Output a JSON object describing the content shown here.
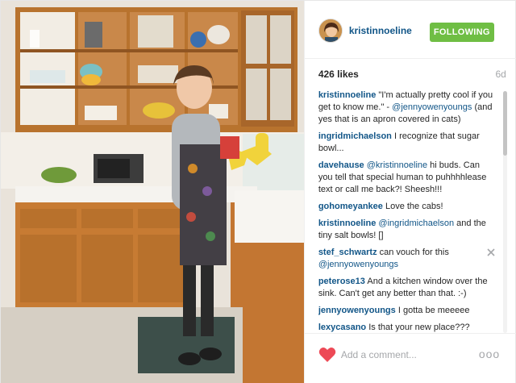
{
  "post": {
    "username": "kristinnoeline",
    "follow_label": "FOLLOWING",
    "likes": "426 likes",
    "age": "6d",
    "comments": [
      {
        "author": "kristinnoeline",
        "parts": [
          {
            "t": "\"I'm actually pretty cool if you get to know me.\" - "
          },
          {
            "m": "@jennyowenyoungs"
          },
          {
            "t": " (and yes that is an apron covered in cats)"
          }
        ]
      },
      {
        "author": "ingridmichaelson",
        "parts": [
          {
            "t": "I recognize that sugar bowl..."
          }
        ]
      },
      {
        "author": "davehause",
        "parts": [
          {
            "m": "@kristinnoeline"
          },
          {
            "t": " hi buds. Can you tell that special human to puhhhhlease text or call me back?! Sheesh!!!"
          }
        ]
      },
      {
        "author": "gohomeyankee",
        "parts": [
          {
            "t": "Love the cabs!"
          }
        ]
      },
      {
        "author": "kristinnoeline",
        "parts": [
          {
            "m": "@ingridmichaelson"
          },
          {
            "t": " and the tiny salt bowls! []"
          }
        ]
      },
      {
        "author": "stef_schwartz",
        "parts": [
          {
            "t": "can vouch for this "
          },
          {
            "m": "@jennyowenyoungs"
          }
        ],
        "deletable": true
      },
      {
        "author": "peterose13",
        "parts": [
          {
            "t": "And a kitchen window over the sink. Can't get any better than that. :-)"
          }
        ]
      },
      {
        "author": "jennyowenyoungs",
        "parts": [
          {
            "t": "I gotta be meeeee"
          }
        ]
      },
      {
        "author": "lexycasano",
        "parts": [
          {
            "t": "Is that your new place???"
          }
        ]
      }
    ],
    "add_comment_placeholder": "Add a comment...",
    "more_label": "ooo"
  },
  "icons": {
    "heart": "heart-icon",
    "close": "close-icon",
    "avatar": "avatar"
  },
  "colors": {
    "link_blue": "#125688",
    "follow_green": "#6fbe44",
    "heart_red": "#ed4956",
    "muted_gray": "#a5a7aa"
  }
}
